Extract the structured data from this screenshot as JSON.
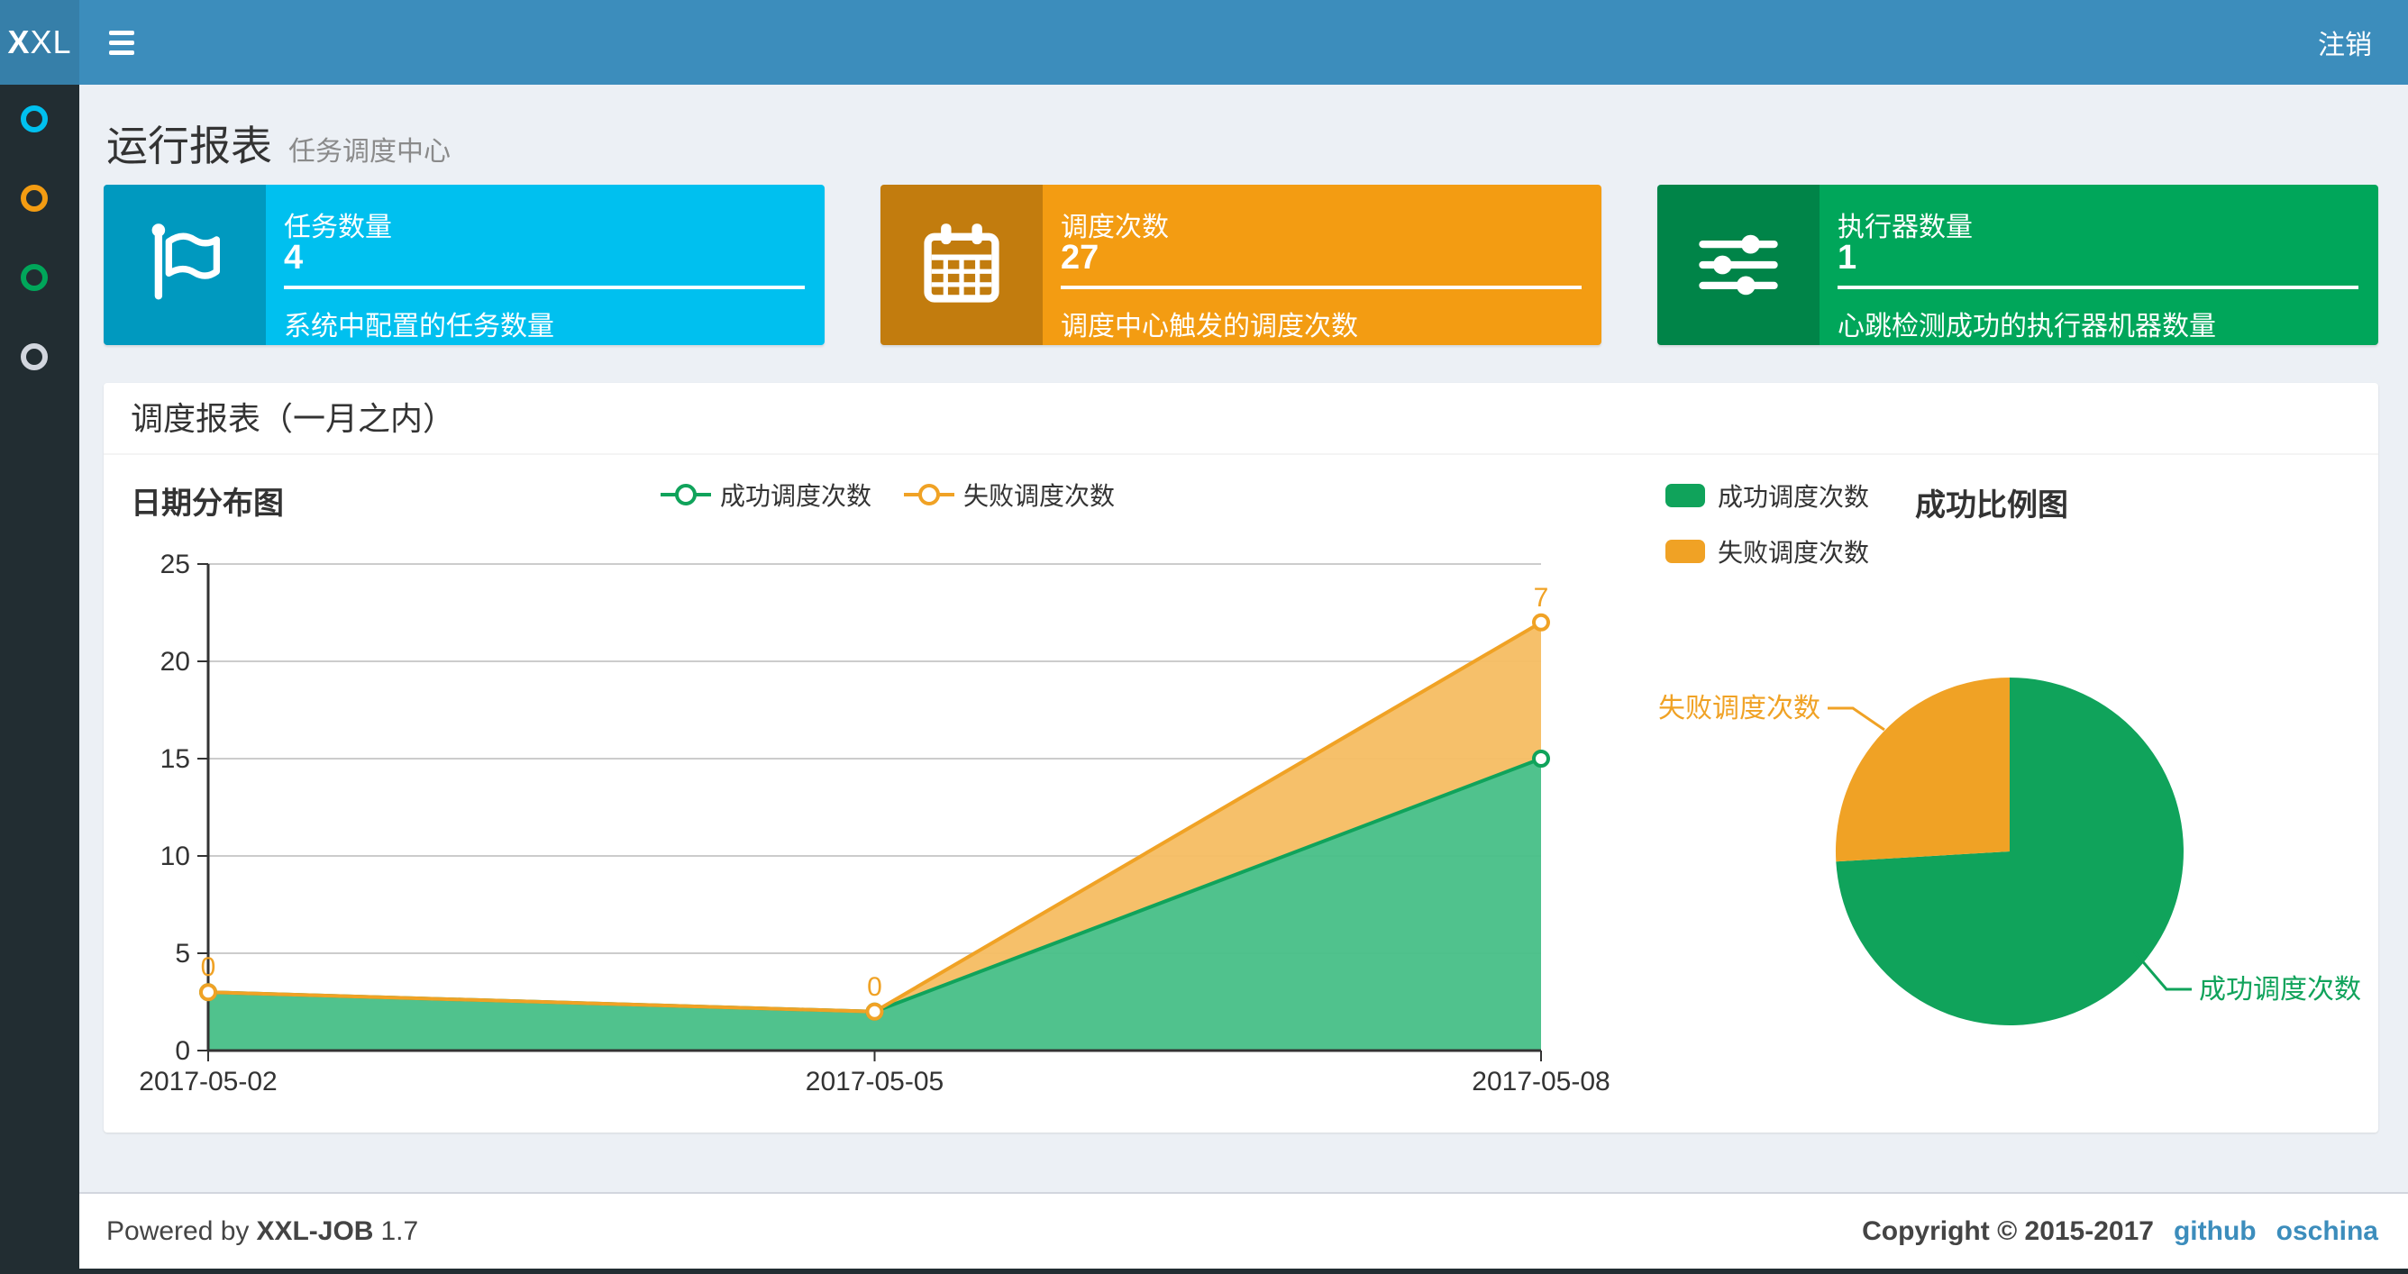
{
  "navbar": {
    "logo_prefix": "X",
    "logo_suffix": "XL",
    "logout_label": "注销",
    "bar_color": "#3c8dbc",
    "logo_bg": "#367fa9"
  },
  "sidebar": {
    "bg": "#222d32",
    "items": [
      {
        "icon": "circle-outline",
        "color": "#00c0ef"
      },
      {
        "icon": "circle-outline",
        "color": "#f39c12"
      },
      {
        "icon": "circle-outline",
        "color": "#00a65a"
      },
      {
        "icon": "circle-outline",
        "color": "#d2d6de"
      }
    ]
  },
  "page_header": {
    "title": "运行报表",
    "subtitle": "任务调度中心"
  },
  "stat_cards": [
    {
      "label": "任务数量",
      "value": "4",
      "description": "系统中配置的任务数量",
      "color": "#00c0ef",
      "icon": "flag-icon"
    },
    {
      "label": "调度次数",
      "value": "27",
      "description": "调度中心触发的调度次数",
      "color": "#f39c12",
      "icon": "calendar-icon"
    },
    {
      "label": "执行器数量",
      "value": "1",
      "description": "心跳检测成功的执行器机器数量",
      "color": "#00a65a",
      "icon": "sliders-icon"
    }
  ],
  "panel": {
    "title": "调度报表（一月之内）"
  },
  "chart_data": [
    {
      "id": "date_distribution",
      "type": "area",
      "title": "日期分布图",
      "x": [
        "2017-05-02",
        "2017-05-05",
        "2017-05-08"
      ],
      "stacked": true,
      "series": [
        {
          "name": "成功调度次数",
          "values": [
            3,
            2,
            15
          ],
          "color": "#10a35b",
          "fill": "#47bf87",
          "labels_shown": false
        },
        {
          "name": "失败调度次数",
          "values": [
            0,
            0,
            7
          ],
          "color": "#f0a225",
          "fill": "#f5bd62",
          "labels_shown": true,
          "labels": [
            "0",
            "0",
            "7"
          ]
        }
      ],
      "ylim": [
        0,
        25
      ],
      "y_ticks": [
        0,
        5,
        10,
        15,
        20,
        25
      ],
      "grid": true,
      "grid_color": "#cccccc",
      "axis_color": "#333333",
      "legend_position": "top-center"
    },
    {
      "id": "success_ratio",
      "type": "pie",
      "title": "成功比例图",
      "slices": [
        {
          "name": "成功调度次数",
          "value": 20,
          "color": "#10a35b"
        },
        {
          "name": "失败调度次数",
          "value": 7,
          "color": "#f0a225"
        }
      ],
      "start_angle_deg": -90,
      "clockwise": true,
      "legend_position": "top-left"
    }
  ],
  "footer": {
    "powered_prefix": "Powered by",
    "product": "XXL-JOB",
    "version": "1.7",
    "copyright": "Copyright © 2015-2017",
    "links": [
      "github",
      "oschina"
    ],
    "link_color": "#3c8dbc"
  }
}
